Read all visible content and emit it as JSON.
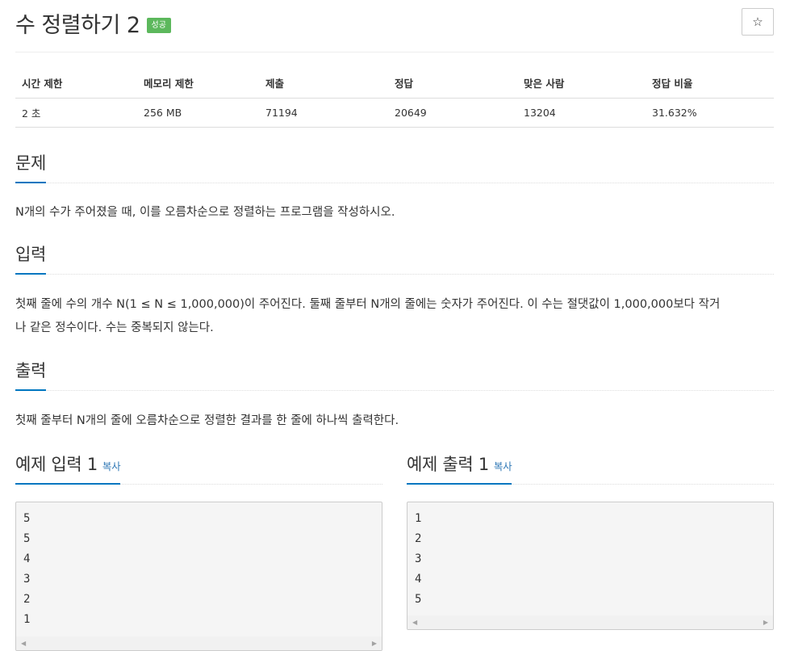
{
  "header": {
    "title": "수 정렬하기 2",
    "badge": "성공",
    "star_glyph": "☆"
  },
  "info_table": {
    "headers": [
      "시간 제한",
      "메모리 제한",
      "제출",
      "정답",
      "맞은 사람",
      "정답 비율"
    ],
    "values": [
      "2 초",
      "256 MB",
      "71194",
      "20649",
      "13204",
      "31.632%"
    ]
  },
  "problem": {
    "heading": "문제",
    "text": "N개의 수가 주어졌을 때, 이를 오름차순으로 정렬하는 프로그램을 작성하시오."
  },
  "input": {
    "heading": "입력",
    "text_line1": "첫째 줄에 수의 개수 N(1 ≤ N ≤ 1,000,000)이 주어진다. 둘째 줄부터 N개의 줄에는 숫자가 주어진다. 이 수는 절댓값이 1,000,000보다 작거",
    "text_line2": "나 같은 정수이다. 수는 중복되지 않는다."
  },
  "output": {
    "heading": "출력",
    "text": "첫째 줄부터 N개의 줄에 오름차순으로 정렬한 결과를 한 줄에 하나씩 출력한다."
  },
  "sample_input": {
    "heading": "예제 입력 1",
    "copy_label": "복사",
    "lines": [
      "5",
      "5",
      "4",
      "3",
      "2",
      "1"
    ]
  },
  "sample_output": {
    "heading": "예제 출력 1",
    "copy_label": "복사",
    "lines": [
      "1",
      "2",
      "3",
      "4",
      "5"
    ]
  },
  "scroll": {
    "left_glyph": "◀",
    "right_glyph": "▶"
  },
  "colors": {
    "accent": "#0076c0",
    "badge": "#5cb85c",
    "link": "#337ab7",
    "sample_bg": "#f5f5f5"
  }
}
